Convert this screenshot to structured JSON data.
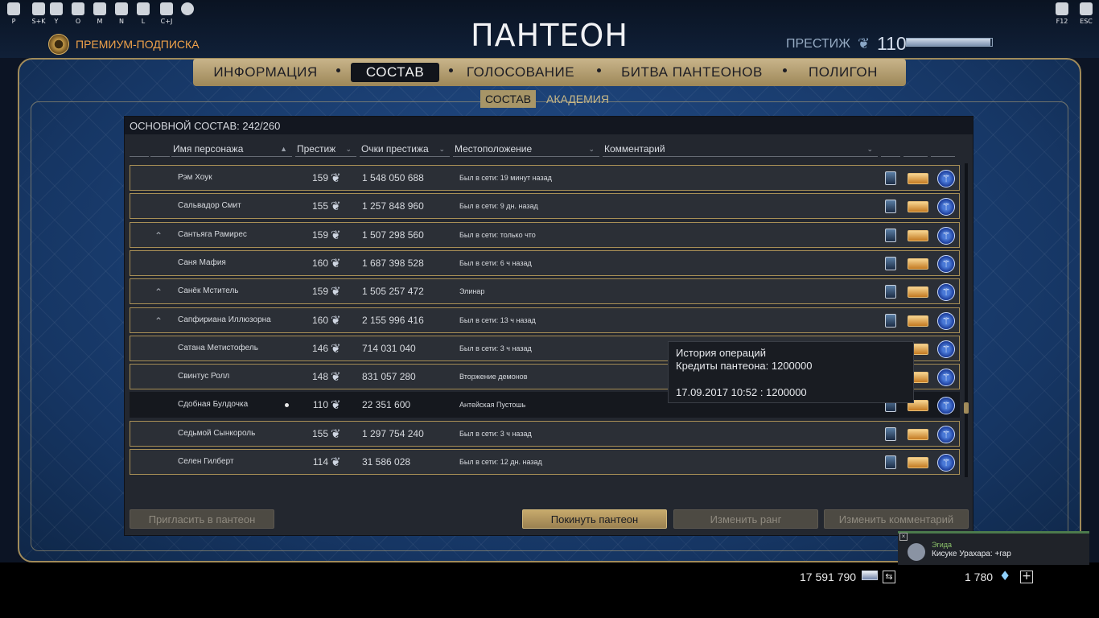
{
  "hotkeys": [
    {
      "key": "P",
      "icon": "player-icon"
    },
    {
      "key": "S+K",
      "icon": "skills-icon"
    },
    {
      "key": "Y",
      "icon": "chat-icon"
    },
    {
      "key": "O",
      "icon": "pantheon-banner-icon"
    },
    {
      "key": "M",
      "icon": "mail-icon"
    },
    {
      "key": "N",
      "icon": "mask-icon"
    },
    {
      "key": "L",
      "icon": "demon-icon"
    },
    {
      "key": "C+J",
      "icon": "moon-icon"
    },
    {
      "key": "",
      "icon": "gear-icon"
    }
  ],
  "top_right_keys": [
    {
      "key": "F12",
      "icon": "window-icon"
    },
    {
      "key": "ESC",
      "icon": "exit-icon"
    }
  ],
  "title": "ПАНТЕОН",
  "premium": {
    "label": "ПРЕМИУМ-ПОДПИСКА"
  },
  "prestige": {
    "label": "ПРЕСТИЖ",
    "value": "110",
    "bar_fraction": 0.98
  },
  "main_tabs": [
    "ИНФОРМАЦИЯ",
    "СОСТАВ",
    "ГОЛОСОВАНИЕ",
    "БИТВА ПАНТЕОНОВ",
    "ПОЛИГОН"
  ],
  "active_main_tab": "СОСТАВ",
  "sub_tabs": [
    "СОСТАВ",
    "АКАДЕМИЯ"
  ],
  "panel_title": "ОСНОВНОЙ СОСТАВ: 242/260",
  "columns": {
    "name": "Имя персонажа",
    "prestige": "Престиж",
    "points": "Очки престижа",
    "location": "Местоположение",
    "comment": "Комментарий"
  },
  "members": [
    {
      "name": "Рэм Хоук",
      "rank": "",
      "prestige": "159",
      "points": "1 548 050 688",
      "location": "Был в сети: 19 минут назад"
    },
    {
      "name": "Сальвадор Смит",
      "rank": "",
      "prestige": "155",
      "points": "1 257 848 960",
      "location": "Был в сети: 9 дн. назад"
    },
    {
      "name": "Сантьяга Рамирес",
      "rank": "^",
      "prestige": "159",
      "points": "1 507 298 560",
      "location": "Был в сети: только что"
    },
    {
      "name": "Саня Мафия",
      "rank": "",
      "prestige": "160",
      "points": "1 687 398 528",
      "location": "Был в сети: 6 ч назад"
    },
    {
      "name": "Санёк Мститель",
      "rank": "^",
      "prestige": "159",
      "points": "1 505 257 472",
      "location": "Элинар"
    },
    {
      "name": "Сапфириана Иллюзорна",
      "rank": "^",
      "prestige": "160",
      "points": "2 155 996 416",
      "location": "Был в сети: 13 ч назад"
    },
    {
      "name": "Сатана Метистофель",
      "rank": "",
      "prestige": "146",
      "points": "714 031 040",
      "location": "Был в сети: 3 ч назад"
    },
    {
      "name": "Свинтус Ролл",
      "rank": "",
      "prestige": "148",
      "points": "831 057 280",
      "location": "Вторжение демонов"
    },
    {
      "name": "Сдобная Булдочка",
      "rank": "",
      "prestige": "110",
      "points": "22 351 600",
      "location": "Антейская Пустошь",
      "selected": true
    },
    {
      "name": "Седьмой Сынкороль",
      "rank": "",
      "prestige": "155",
      "points": "1 297 754 240",
      "location": "Был в сети: 3 ч назад"
    },
    {
      "name": "Селен Гилберт",
      "rank": "",
      "prestige": "114",
      "points": "31 586 028",
      "location": "Был в сети: 12 дн. назад"
    }
  ],
  "row_icons": [
    "shield-icon",
    "credits-icon",
    "rank-badge-icon"
  ],
  "buttons": {
    "invite": "Пригласить в пантеон",
    "leave": "Покинуть пантеон",
    "change_rank": "Изменить ранг",
    "change_comment": "Изменить комментарий"
  },
  "tooltip": {
    "title": "История операций",
    "line1": "Кредиты пантеона: 1200000",
    "line2": "17.09.2017 10:52 : 1200000"
  },
  "currency": {
    "credits": "17 591 790",
    "crystals": "1 780"
  },
  "notification": {
    "sender": "Эгида",
    "text": "Кисуке Урахара: +гар"
  },
  "colors": {
    "gold": "#a18b5a",
    "accent_orange": "#f0a24a",
    "frame_blue": "#1b3e74"
  }
}
